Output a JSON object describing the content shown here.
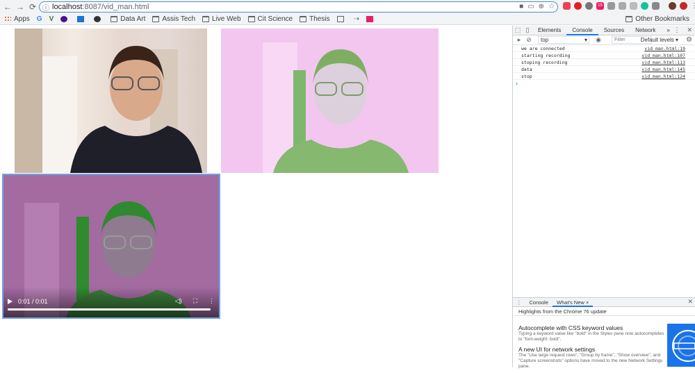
{
  "browser": {
    "url_host": "localhost",
    "url_rest": ":8087/vid_man.html",
    "bookmarks": [
      "Apps",
      "Data Art",
      "Assis Tech",
      "Live Web",
      "Cit Science",
      "Thesis"
    ],
    "other_bookmarks": "Other Bookmarks",
    "ext_badge": "15"
  },
  "video": {
    "time": "0:01 / 0:01"
  },
  "devtools": {
    "tabs": [
      "Elements",
      "Console",
      "Sources",
      "Network"
    ],
    "more_tabs": "»",
    "context": "top",
    "filter_placeholder": "Filter",
    "levels": "Default levels ▾",
    "logs": [
      {
        "msg": "we are connected",
        "src": "vid_man.html:19"
      },
      {
        "msg": "starting recording",
        "src": "vid_man.html:107"
      },
      {
        "msg": "stoping recording",
        "src": "vid_man.html:113"
      },
      {
        "msg": "data",
        "src": "vid_man.html:145"
      },
      {
        "msg": "stop",
        "src": "vid_man.html:124"
      }
    ],
    "prompt": "›",
    "drawer": {
      "tabs": [
        "Console",
        "What's New ×"
      ],
      "highlights": "Highlights from the Chrome 76 update",
      "items": [
        {
          "title": "Autocomplete with CSS keyword values",
          "desc": "Typing a keyword value like \"bold\" in the Styles pane now autocompletes to \"font-weight: bold\"."
        },
        {
          "title": "A new UI for network settings",
          "desc": "The \"Use large request rows\", \"Group by frame\", \"Show overview\", and \"Capture screenshots\" options have moved to the new Network Settings pane."
        }
      ]
    }
  }
}
